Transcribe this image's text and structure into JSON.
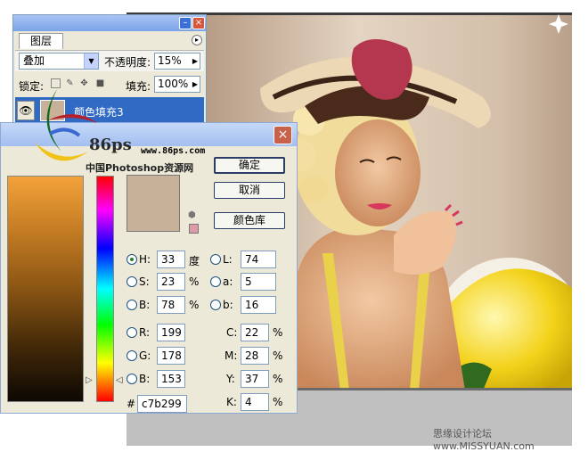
{
  "layers_panel": {
    "tab_label": "图层",
    "blend_mode": "叠加",
    "opacity_label": "不透明度:",
    "opacity_value": "15%",
    "lock_label": "锁定:",
    "fill_label": "填充:",
    "fill_value": "100%",
    "layer_name": "颜色填充3",
    "layer_color": "#c7b299"
  },
  "picker": {
    "ok_label": "确定",
    "cancel_label": "取消",
    "library_label": "颜色库",
    "logo_number": "86ps",
    "logo_url": "www.86ps.com",
    "logo_site": "中国Photoshop资源网",
    "selected_mode": "H",
    "hsb": {
      "h_label": "H:",
      "h_value": "33",
      "h_unit": "度",
      "s_label": "S:",
      "s_value": "23",
      "s_unit": "%",
      "b_label": "B:",
      "b_value": "78",
      "b_unit": "%"
    },
    "lab": {
      "l_label": "L:",
      "l_value": "74",
      "a_label": "a:",
      "a_value": "5",
      "b_label": "b:",
      "b_value": "16"
    },
    "rgb": {
      "r_label": "R:",
      "r_value": "199",
      "g_label": "G:",
      "g_value": "178",
      "b_label": "B:",
      "b_value": "153"
    },
    "cmyk": {
      "c_label": "C:",
      "c_value": "22",
      "c_unit": "%",
      "m_label": "M:",
      "m_value": "28",
      "m_unit": "%",
      "y_label": "Y:",
      "y_value": "37",
      "y_unit": "%",
      "k_label": "K:",
      "k_value": "4",
      "k_unit": "%"
    },
    "hex_label": "#",
    "hex_value": "c7b299",
    "current_color": "#c7b299",
    "gamut_warning_color": "#df9aa8"
  },
  "watermark": "思缘设计论坛 www.MISSYUAN.com"
}
